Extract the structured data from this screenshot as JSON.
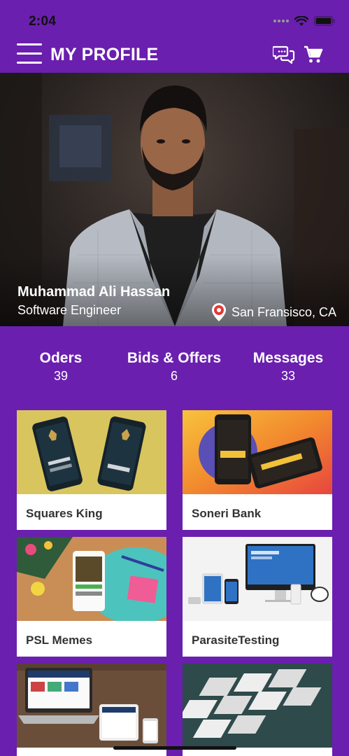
{
  "status": {
    "time": "2:04"
  },
  "appbar": {
    "title": "MY PROFILE"
  },
  "profile": {
    "name": "Muhammad Ali Hassan",
    "role": "Software Engineer",
    "location": "San Fransisco, CA"
  },
  "stats": [
    {
      "label": "Oders",
      "value": "39"
    },
    {
      "label": "Bids & Offers",
      "value": "6"
    },
    {
      "label": "Messages",
      "value": "33"
    }
  ],
  "portfolio": [
    {
      "title": "Squares King"
    },
    {
      "title": "Soneri Bank"
    },
    {
      "title": "PSL Memes"
    },
    {
      "title": "ParasiteTesting"
    },
    {
      "title": ""
    },
    {
      "title": ""
    }
  ],
  "colors": {
    "primary": "#6A1FAE",
    "location_pin": "#E53935"
  },
  "icons": [
    "menu-icon",
    "chat-icon",
    "cart-icon",
    "location-pin-icon",
    "wifi-icon",
    "battery-icon",
    "signal-icon"
  ]
}
